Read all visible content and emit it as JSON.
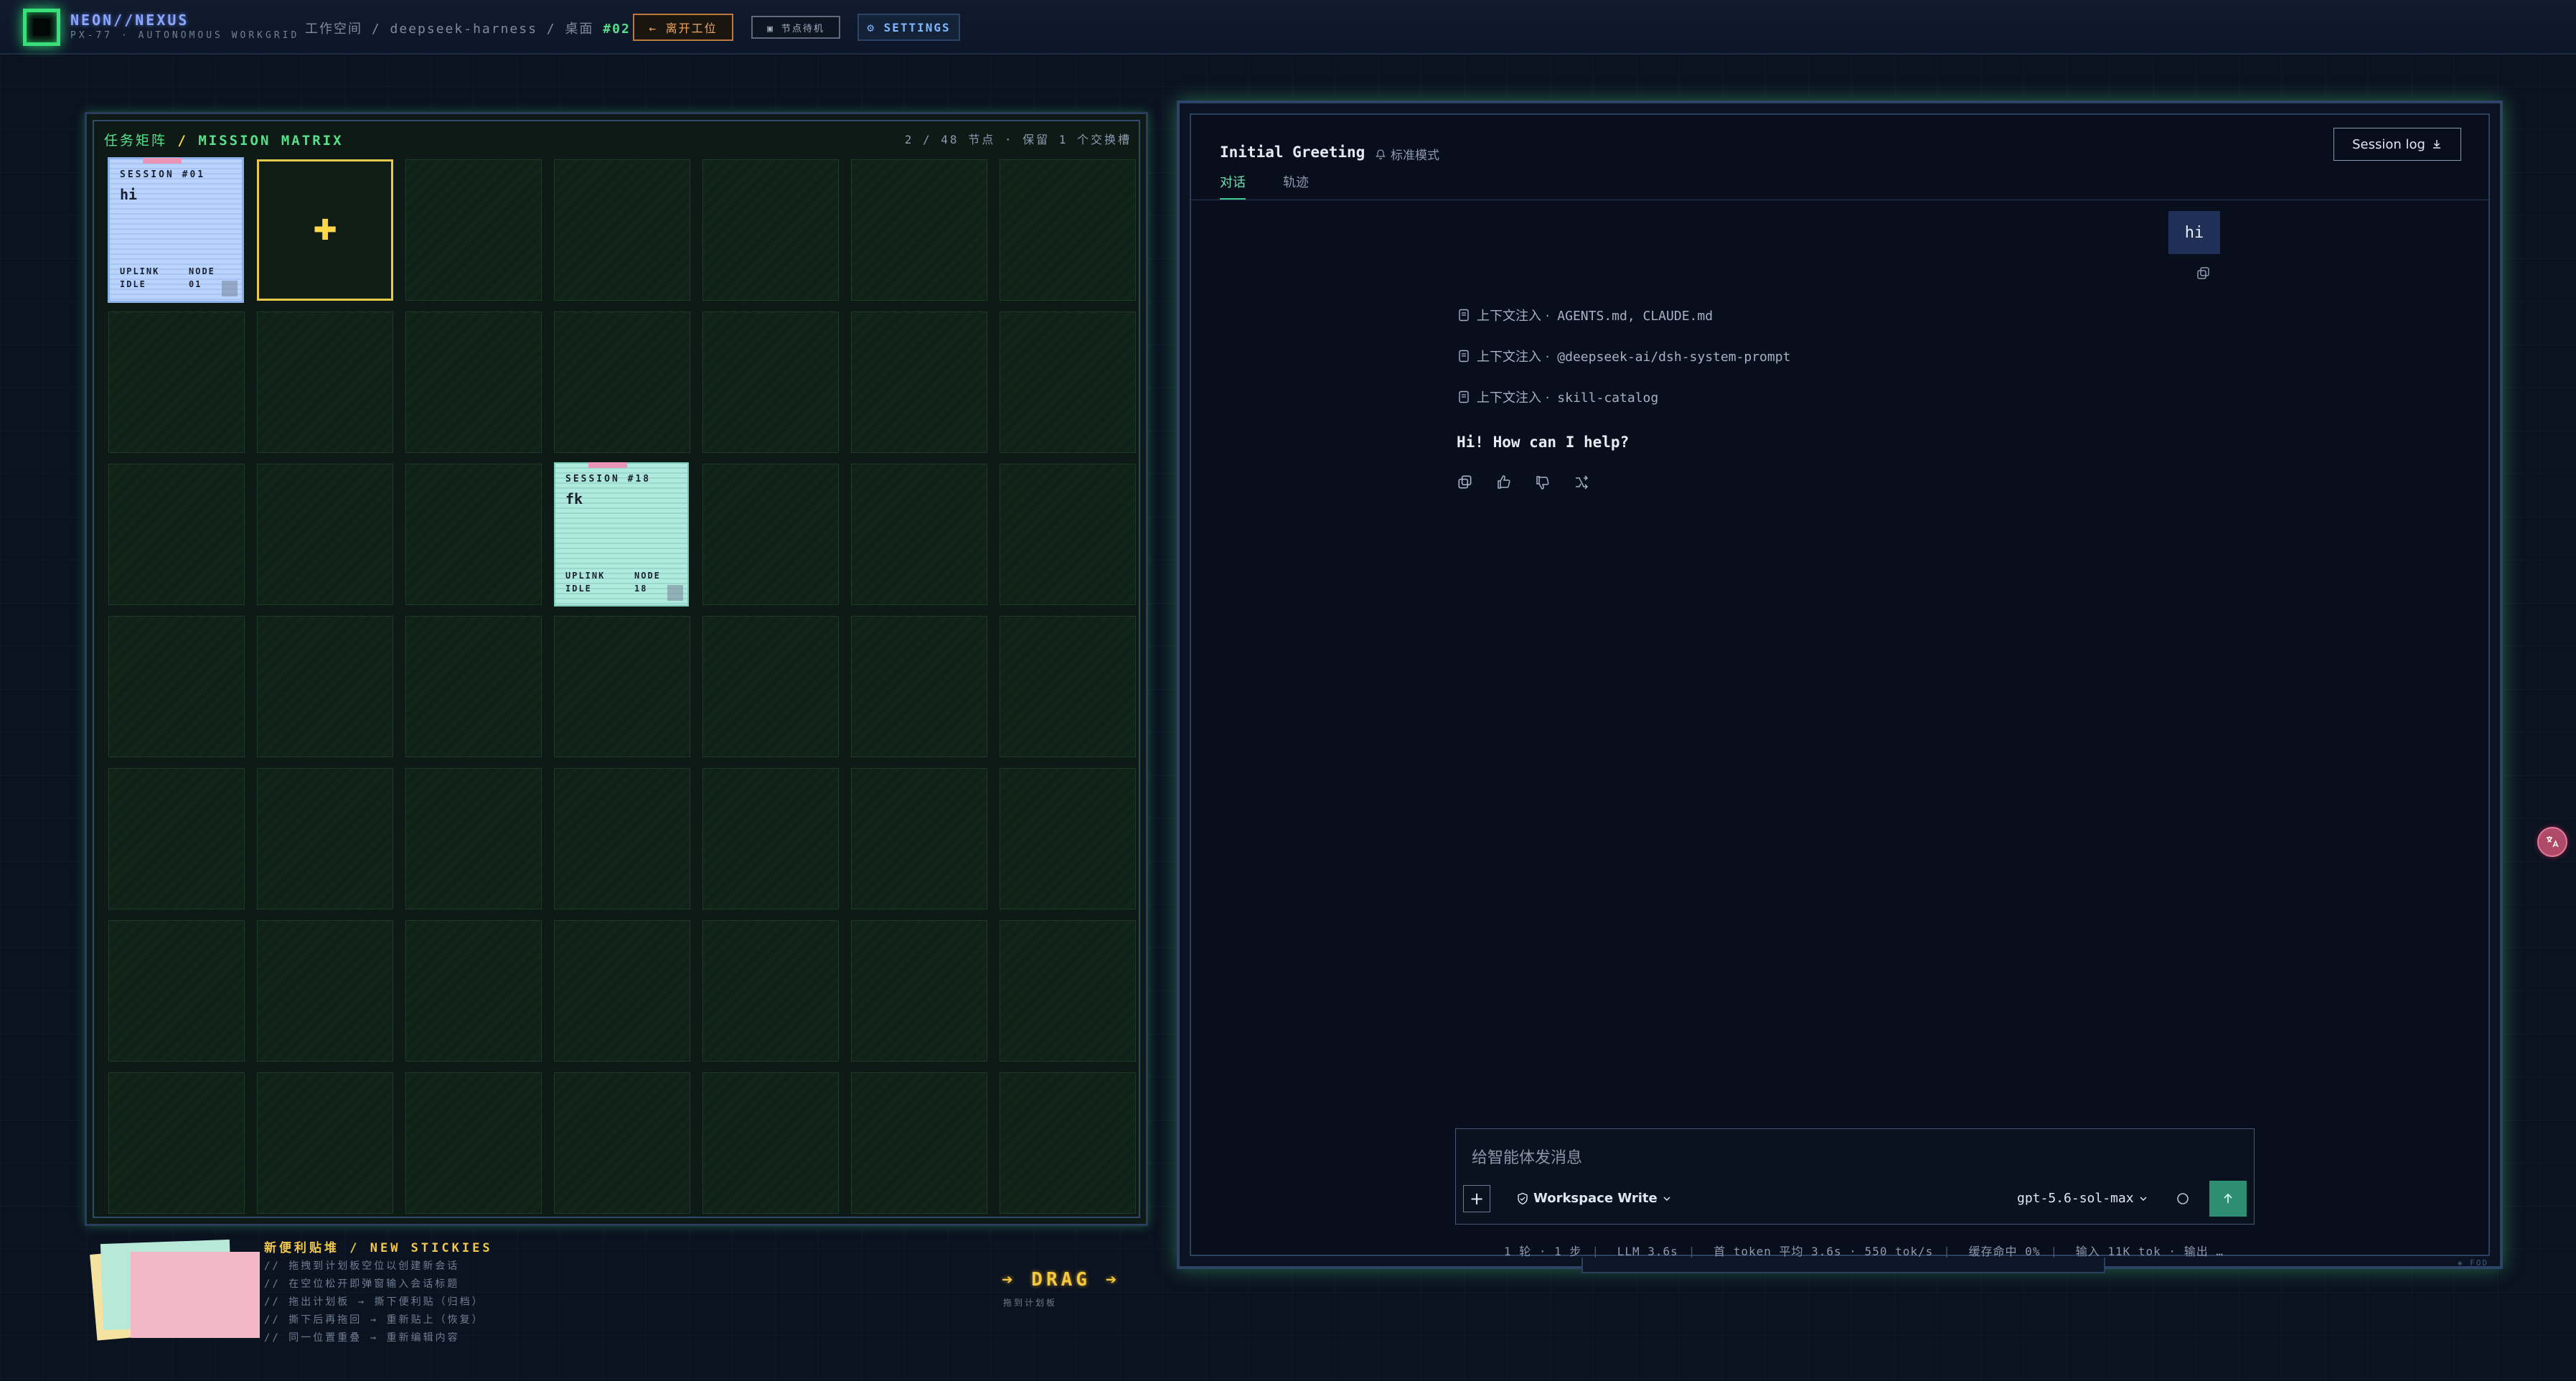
{
  "header": {
    "brand": "NEON//NEXUS",
    "brand_sub": "PX-77 · AUTONOMOUS WORKGRID",
    "crumb_workspace": "工作空间",
    "crumb_project": "deepseek-harness",
    "crumb_desk_label": "桌面",
    "crumb_desk_no": "#02",
    "leave_button": "← 离开工位",
    "standby_button": "▣ 节点待机",
    "settings_button": "⚙ SETTINGS"
  },
  "matrix": {
    "title_cn": "任务矩阵",
    "title_en": "MISSION MATRIX",
    "stat": "2 / 48 节点 · 保留 1 个交换槽",
    "stickies": [
      {
        "id": "SESSION #01",
        "title": "hi",
        "f1": "UPLINK",
        "f2": "NODE",
        "f3": "IDLE",
        "f4": "01",
        "color": "#b9d3ff"
      },
      {
        "id": "SESSION #18",
        "title": "fk",
        "f1": "UPLINK",
        "f2": "NODE",
        "f3": "IDLE",
        "f4": "18",
        "color": "#aeeadd"
      }
    ],
    "add_symbol": "✚"
  },
  "new_stickies": {
    "title_cn": "新便利贴堆",
    "title_en": "NEW STICKIES",
    "lines": [
      "// 拖拽到计划板空位以创建新会话",
      "// 在空位松开即弹窗输入会话标题",
      "// 拖出计划板 → 撕下便利贴（归档）",
      "// 撕下后再拖回 → 重新贴上（恢复）",
      "// 同一位置重叠 → 重新编辑内容"
    ],
    "drag_label": "➔ DRAG ➔",
    "drag_sub": "拖到计划板"
  },
  "chat": {
    "title": "Initial Greeting",
    "mode": "标准模式",
    "session_log": "Session log",
    "tabs": [
      "对话",
      "轨迹"
    ],
    "user_message": "hi",
    "context_items": [
      {
        "prefix": "上下文注入 ·",
        "value": "AGENTS.md, CLAUDE.md"
      },
      {
        "prefix": "上下文注入 ·",
        "value": "@deepseek-ai/dsh-system-prompt"
      },
      {
        "prefix": "上下文注入 ·",
        "value": "skill-catalog"
      }
    ],
    "assistant_message": "Hi! How can I help?",
    "composer": {
      "placeholder": "给智能体发消息",
      "workspace": "Workspace Write",
      "model": "gpt-5.6-sol-max"
    },
    "status": [
      "1 轮 · 1 步",
      "LLM 3.6s",
      "首 token 平均 3.6s · 550 tok/s",
      "缓存命中 0%",
      "输入 11K tok · 输出 …"
    ],
    "corner_label": "◈ FOD"
  },
  "colors": {
    "accent_green": "#39e07a",
    "accent_yellow": "#ffd84a",
    "accent_orange": "#f0a860",
    "panel_bg": "#080e1c"
  }
}
